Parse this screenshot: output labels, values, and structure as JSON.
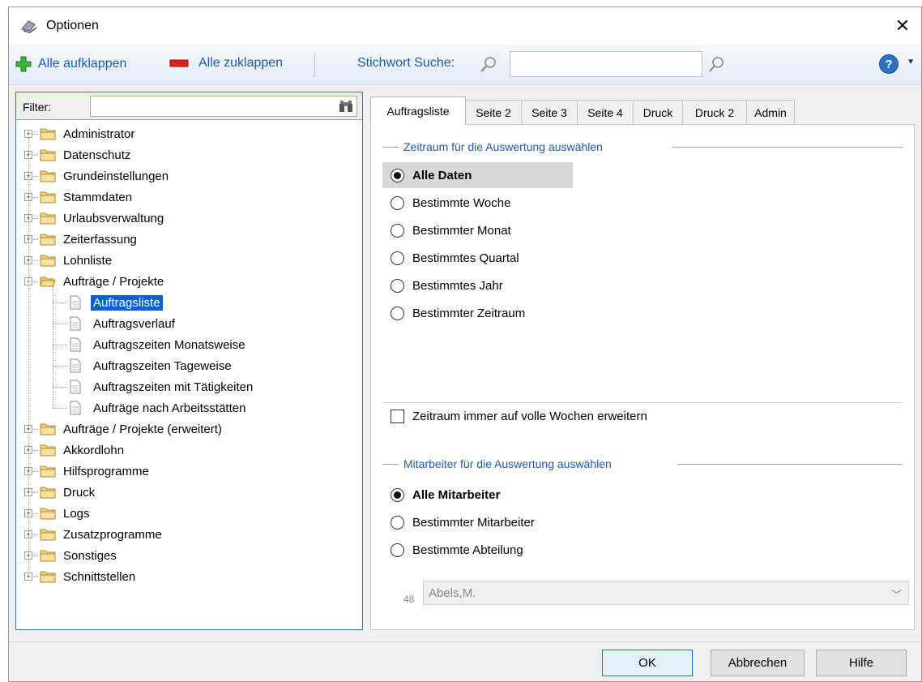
{
  "window": {
    "title": "Optionen",
    "close_glyph": "✕"
  },
  "toolbar": {
    "expand_all": "Alle aufklappen",
    "collapse_all": "Alle zuklappen",
    "search_label": "Stichwort Suche:",
    "search_value": ""
  },
  "filter": {
    "label": "Filter:",
    "value": ""
  },
  "tree": {
    "top": [
      "Administrator",
      "Datenschutz",
      "Grundeinstellungen",
      "Stammdaten",
      "Urlaubsverwaltung",
      "Zeiterfassung",
      "Lohnliste"
    ],
    "expanded": "Aufträge / Projekte",
    "children": [
      "Auftragsliste",
      "Auftragsverlauf",
      "Auftragszeiten Monatsweise",
      "Auftragszeiten Tageweise",
      "Auftragszeiten mit Tätigkeiten",
      "Aufträge nach Arbeitsstätten"
    ],
    "bottom": [
      "Aufträge / Projekte (erweitert)",
      "Akkordlohn",
      "Hilfsprogramme",
      "Druck",
      "Logs",
      "Zusatzprogramme",
      "Sonstiges",
      "Schnittstellen"
    ],
    "selected": "Auftragsliste"
  },
  "tabs": [
    "Auftragsliste",
    "Seite 2",
    "Seite 3",
    "Seite 4",
    "Druck",
    "Druck 2",
    "Admin"
  ],
  "period_group": {
    "title": "Zeitraum für die Auswertung auswählen",
    "options": [
      "Alle Daten",
      "Bestimmte Woche",
      "Bestimmter Monat",
      "Bestimmtes Quartal",
      "Bestimmtes Jahr",
      "Bestimmter Zeitraum"
    ],
    "selected_index": 0
  },
  "extend_weeks": {
    "label": "Zeitraum immer auf volle Wochen erweitern",
    "checked": false
  },
  "employee_group": {
    "title": "Mitarbeiter für die Auswertung auswählen",
    "options": [
      "Alle Mitarbeiter",
      "Bestimmter Mitarbeiter",
      "Bestimmte Abteilung"
    ],
    "selected_index": 0
  },
  "employee_combo": {
    "number": "48",
    "value": "Abels,M."
  },
  "buttons": {
    "ok": "OK",
    "cancel": "Abbrechen",
    "help": "Hilfe"
  },
  "colors": {
    "accent": "#1f5aa6",
    "selection": "#0a62c9"
  }
}
